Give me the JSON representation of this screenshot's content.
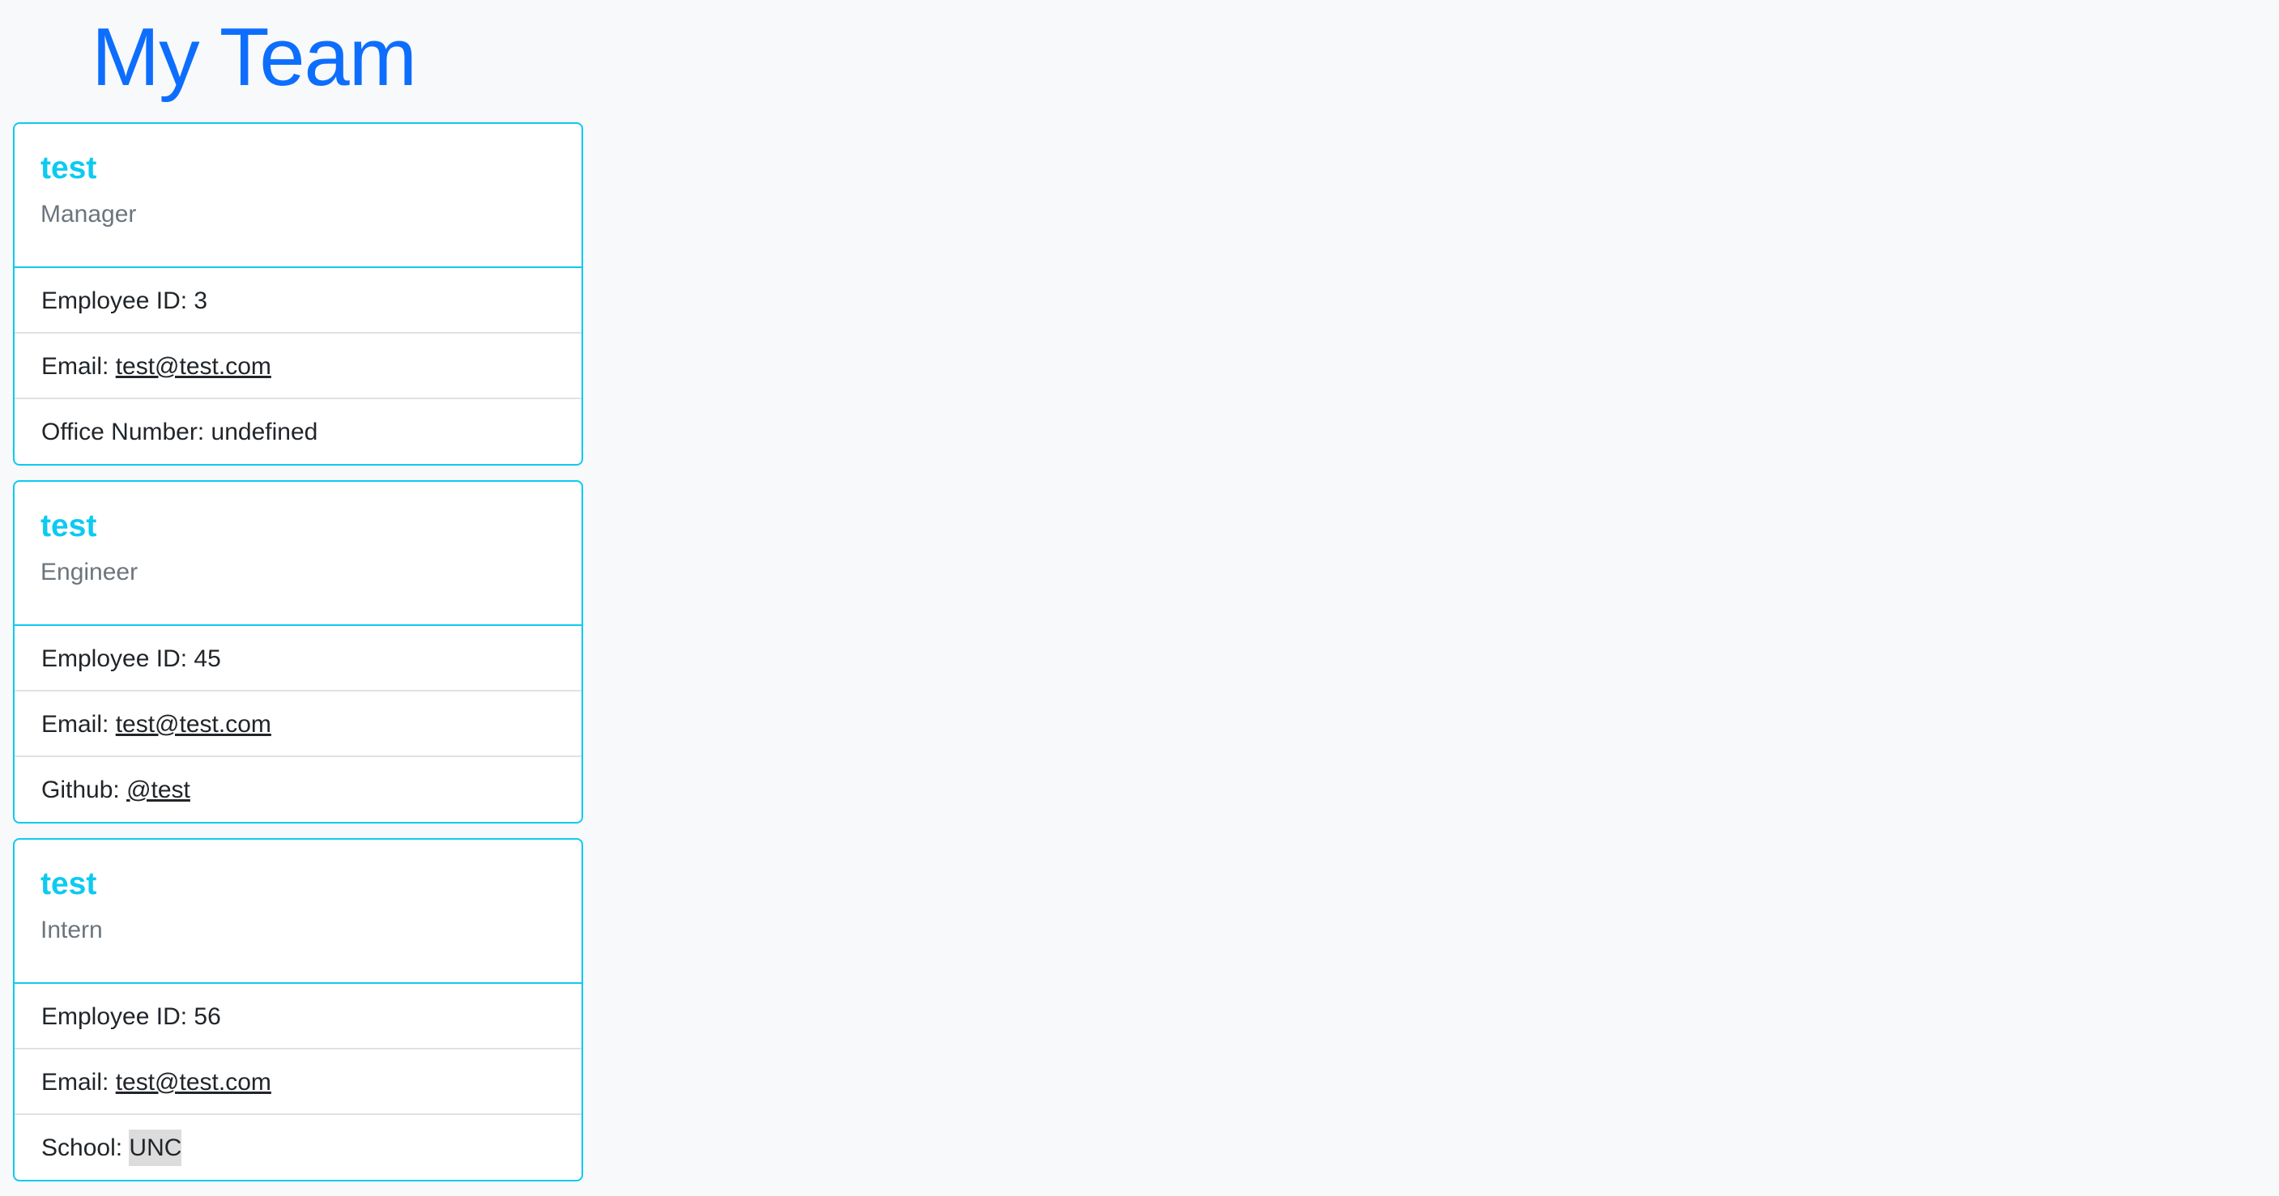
{
  "header": {
    "title": "My Team"
  },
  "colors": {
    "title": "#0d6efd",
    "accent": "#0dcaf0",
    "role_text": "#6c757d",
    "body_text": "#212529",
    "divider": "#dee2e6",
    "background": "#f8f9fa",
    "highlight": "#dcdcdc"
  },
  "team": [
    {
      "name": "test",
      "role": "Manager",
      "id_label": "Employee ID:",
      "id_value": "3",
      "email_label": "Email:",
      "email_value": "test@test.com",
      "extra_label": "Office Number:",
      "extra_value": "undefined"
    },
    {
      "name": "test",
      "role": "Engineer",
      "id_label": "Employee ID:",
      "id_value": "45",
      "email_label": "Email:",
      "email_value": "test@test.com",
      "extra_label": "Github:",
      "extra_value": "@test"
    },
    {
      "name": "test",
      "role": "Intern",
      "id_label": "Employee ID:",
      "id_value": "56",
      "email_label": "Email:",
      "email_value": "test@test.com",
      "extra_label": "School:",
      "extra_value": "UNC"
    }
  ]
}
